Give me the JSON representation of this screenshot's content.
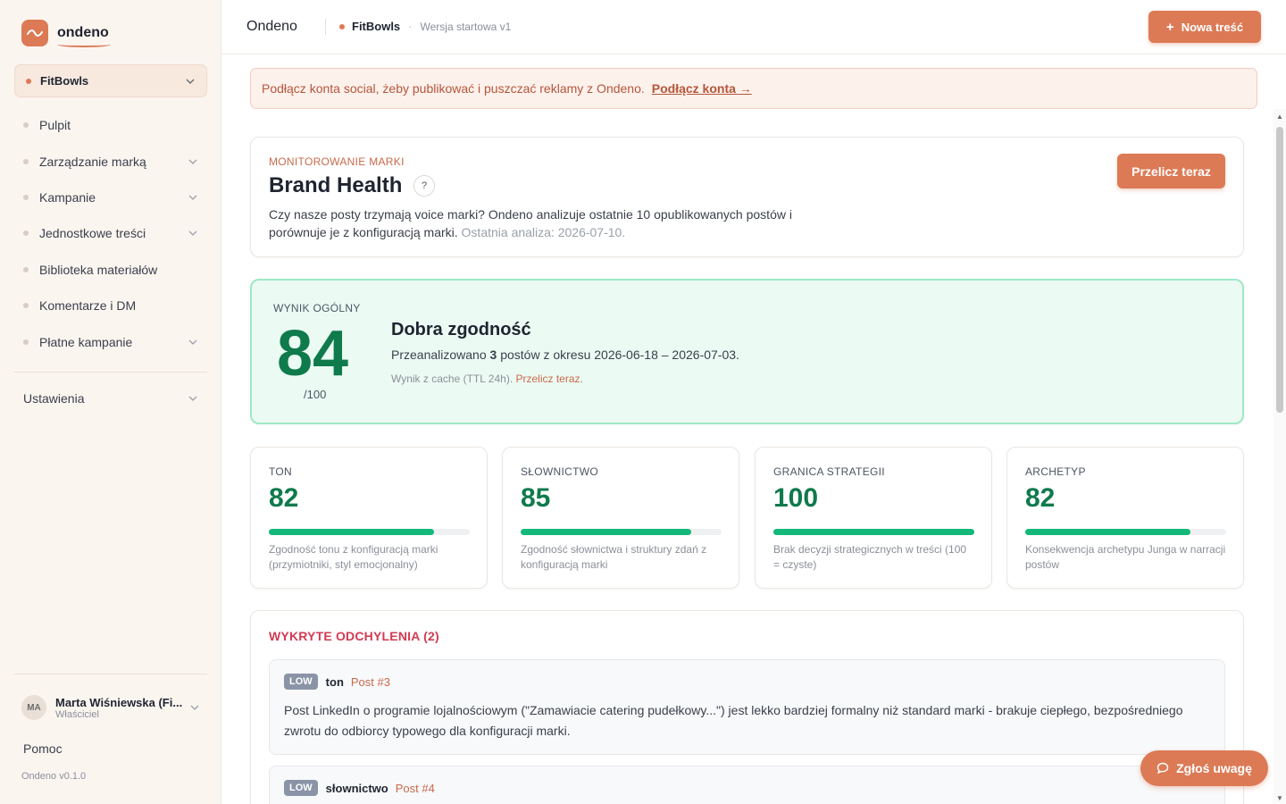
{
  "sidebar": {
    "logo_text": "ondeno",
    "brand_selector": "FitBowls",
    "nav": [
      {
        "label": "Pulpit",
        "has_chevron": false
      },
      {
        "label": "Zarządzanie marką",
        "has_chevron": true
      },
      {
        "label": "Kampanie",
        "has_chevron": true
      },
      {
        "label": "Jednostkowe treści",
        "has_chevron": true
      },
      {
        "label": "Biblioteka materiałów",
        "has_chevron": false
      },
      {
        "label": "Komentarze i DM",
        "has_chevron": false
      },
      {
        "label": "Płatne kampanie",
        "has_chevron": true
      }
    ],
    "settings": "Ustawienia",
    "user": {
      "initials": "MA",
      "name": "Marta Wiśniewska (Fi...",
      "role": "Właściciel"
    },
    "help": "Pomoc",
    "version": "Ondeno v0.1.0"
  },
  "header": {
    "app_title": "Ondeno",
    "brand": "FitBowls",
    "separator": "·",
    "version": "Wersja startowa v1",
    "new_button": "Nowa treść",
    "new_button_icon": "+"
  },
  "alert": {
    "text": "Podłącz konta social, żeby publikować i puszczać reklamy z Ondeno.",
    "link": "Podłącz konta →"
  },
  "brand_health": {
    "eyebrow": "MONITOROWANIE MARKI",
    "title": "Brand Health",
    "help": "?",
    "description": "Czy nasze posty trzymają voice marki? Ondeno analizuje ostatnie 10 opublikowanych postów i porównuje je z konfiguracją marki.",
    "last_analysis": "Ostatnia analiza: 2026-07-10.",
    "recalc_button": "Przelicz teraz"
  },
  "overall": {
    "eyebrow": "WYNIK OGÓLNY",
    "score": "84",
    "out_of": "/100",
    "verdict": "Dobra zgodność",
    "analyzed_prefix": "Przeanalizowano",
    "analyzed_count": "3",
    "analyzed_suffix": "postów z okresu 2026-06-18 – 2026-07-03.",
    "cache_text": "Wynik z cache (TTL 24h).",
    "cache_link": "Przelicz teraz."
  },
  "metrics": [
    {
      "label": "TON",
      "value": "82",
      "fill": 0.82,
      "desc": "Zgodność tonu z konfiguracją marki (przymiotniki, styl emocjonalny)"
    },
    {
      "label": "SŁOWNICTWO",
      "value": "85",
      "fill": 0.85,
      "desc": "Zgodność słownictwa i struktury zdań z konfiguracją marki"
    },
    {
      "label": "GRANICA STRATEGII",
      "value": "100",
      "fill": 1.0,
      "desc": "Brak decyzji strategicznych w treści (100 = czyste)"
    },
    {
      "label": "ARCHETYP",
      "value": "82",
      "fill": 0.82,
      "desc": "Konsekwencja archetypu Junga w narracji postów"
    }
  ],
  "deviations": {
    "title": "WYKRYTE ODCHYLENIA (2)",
    "items": [
      {
        "severity": "LOW",
        "category": "ton",
        "post": "Post #3",
        "text": "Post LinkedIn o programie lojalnościowym (\"Zamawiacie catering pudełkowy...\") jest lekko bardziej formalny niż standard marki - brakuje ciepłego, bezpośredniego zwrotu do odbiorcy typowego dla konfiguracji marki."
      },
      {
        "severity": "LOW",
        "category": "słownictwo",
        "post": "Post #4",
        "text": ""
      }
    ]
  },
  "report_button": "Zgłoś uwagę",
  "colors": {
    "accent": "#dc7a56",
    "success": "#0f7a4c",
    "bar": "#14b879",
    "danger": "#d33a52"
  }
}
